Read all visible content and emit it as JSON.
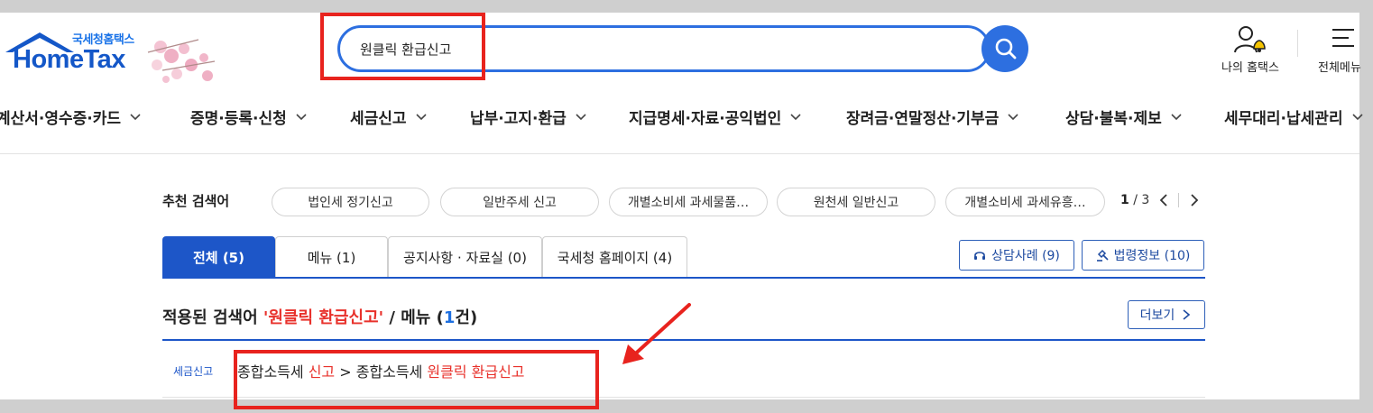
{
  "header": {
    "logo_sub": "국세청홈택스",
    "logo_main": "HomeTax",
    "search_value": "원클릭 환급신고",
    "my_hometax_label": "나의 홈택스",
    "all_menu_label": "전체메뉴"
  },
  "gnb": [
    "계산서·영수증·카드",
    "증명·등록·신청",
    "세금신고",
    "납부·고지·환급",
    "지급명세·자료·공익법인",
    "장려금·연말정산·기부금",
    "상담·불복·제보",
    "세무대리·납세관리"
  ],
  "recommended": {
    "title": "추천 검색어",
    "chips": [
      "법인세 정기신고",
      "일반주세 신고",
      "개별소비세 과세물품…",
      "원천세 일반신고",
      "개별소비세 과세유흥…"
    ],
    "page_current": "1",
    "page_total": "/ 3"
  },
  "tabs": [
    {
      "label": "전체 (5)",
      "active": true
    },
    {
      "label": "메뉴 (1)",
      "active": false
    },
    {
      "label": "공지사항 · 자료실 (0)",
      "active": false
    },
    {
      "label": "국세청 홈페이지 (4)",
      "active": false
    }
  ],
  "side_buttons": {
    "consult": "상담사례 (9)",
    "law": "법령정보 (10)"
  },
  "result": {
    "title_prefix": "적용된 검색어 ",
    "keyword": "'원클릭 환급신고'",
    "title_mid": " / 메뉴 (",
    "count": "1",
    "title_suffix": "건)",
    "more_label": "더보기",
    "category": "세금신고",
    "path_part1": "종합소득세 ",
    "path_part1_red": "신고",
    "path_sep": " > ",
    "path_part2": "종합소득세 ",
    "path_part2_red": "원클릭 환급신고"
  },
  "colors": {
    "accent": "#1d56c8",
    "highlight": "#e8231e",
    "keyword": "#e8312b"
  }
}
